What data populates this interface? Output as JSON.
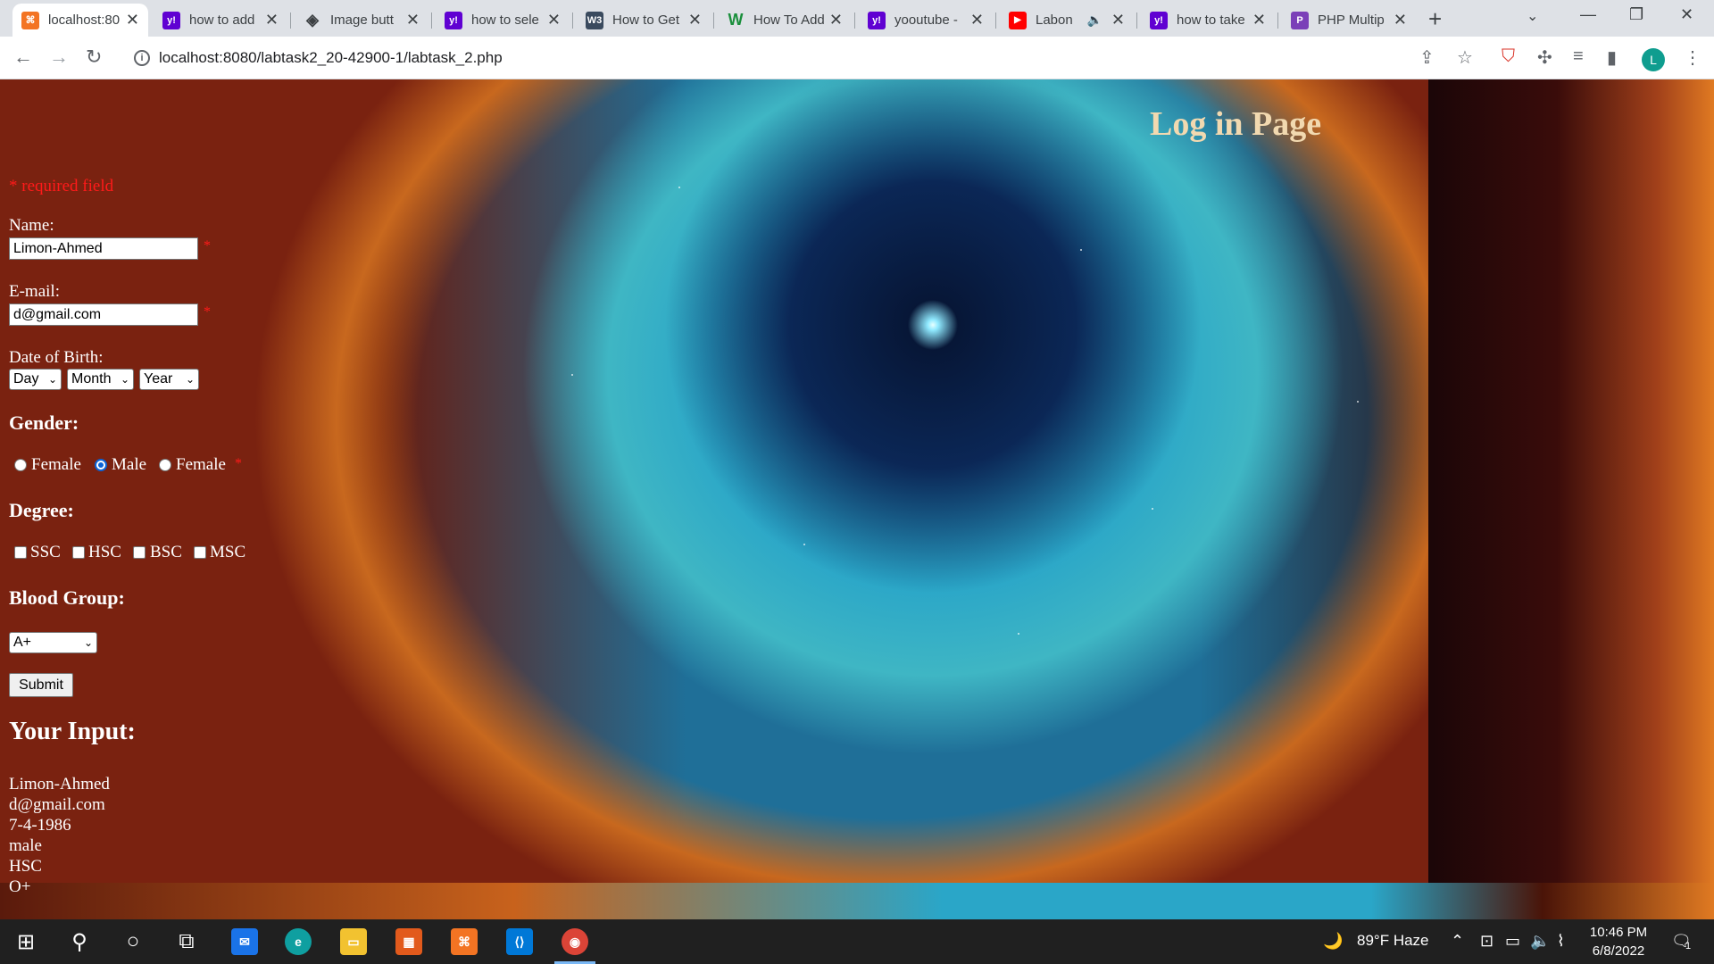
{
  "browser": {
    "tabs": [
      {
        "title": "localhost:80",
        "icon": "xampp-icon",
        "color": "#f37423",
        "glyph": "⌘",
        "active": true
      },
      {
        "title": "how to add",
        "icon": "yahoo-icon",
        "color": "#6001d2",
        "glyph": "y!"
      },
      {
        "title": "Image butt",
        "icon": "diamond-icon",
        "color": "#5f6368",
        "glyph": "◈"
      },
      {
        "title": "how to sele",
        "icon": "yahoo-icon",
        "color": "#6001d2",
        "glyph": "y!"
      },
      {
        "title": "How to Get",
        "icon": "site-icon",
        "color": "#3a4a5e",
        "glyph": "W3"
      },
      {
        "title": "How To Add",
        "icon": "w-icon",
        "color": "#1a8f3c",
        "glyph": "W"
      },
      {
        "title": "yooutube -",
        "icon": "yahoo-icon",
        "color": "#6001d2",
        "glyph": "y!"
      },
      {
        "title": "Labon",
        "icon": "youtube-icon",
        "color": "#ff0000",
        "glyph": "▶"
      },
      {
        "title": "how to take",
        "icon": "yahoo-icon",
        "color": "#6001d2",
        "glyph": "y!"
      },
      {
        "title": "PHP Multip",
        "icon": "php-icon",
        "color": "#7b3fb8",
        "glyph": "P"
      }
    ],
    "url": "localhost:8080/labtask2_20-42900-1/labtask_2.php",
    "profile_initial": "L"
  },
  "page": {
    "heading": "Log in Page",
    "required_note": "* required field",
    "name_label": "Name:",
    "name_value": "Limon-Ahmed",
    "email_label": "E-mail:",
    "email_value": "d@gmail.com",
    "required_mark": "*",
    "dob_label": "Date of Birth:",
    "dob_day": "Day",
    "dob_month": "Month",
    "dob_year": "Year",
    "gender_label": "Gender:",
    "gender_options": [
      "Female",
      "Male",
      "Female"
    ],
    "degree_label": "Degree:",
    "degree_options": [
      "SSC",
      "HSC",
      "BSC",
      "MSC"
    ],
    "blood_label": "Blood Group:",
    "blood_value": "A+",
    "submit_label": "Submit",
    "output_heading": "Your Input:",
    "output_lines": [
      "Limon-Ahmed",
      "d@gmail.com",
      "7-4-1986",
      "male",
      "HSC",
      "O+"
    ]
  },
  "taskbar": {
    "weather": "89°F  Haze",
    "time": "10:46 PM",
    "date": "6/8/2022",
    "notification_count": "1"
  }
}
